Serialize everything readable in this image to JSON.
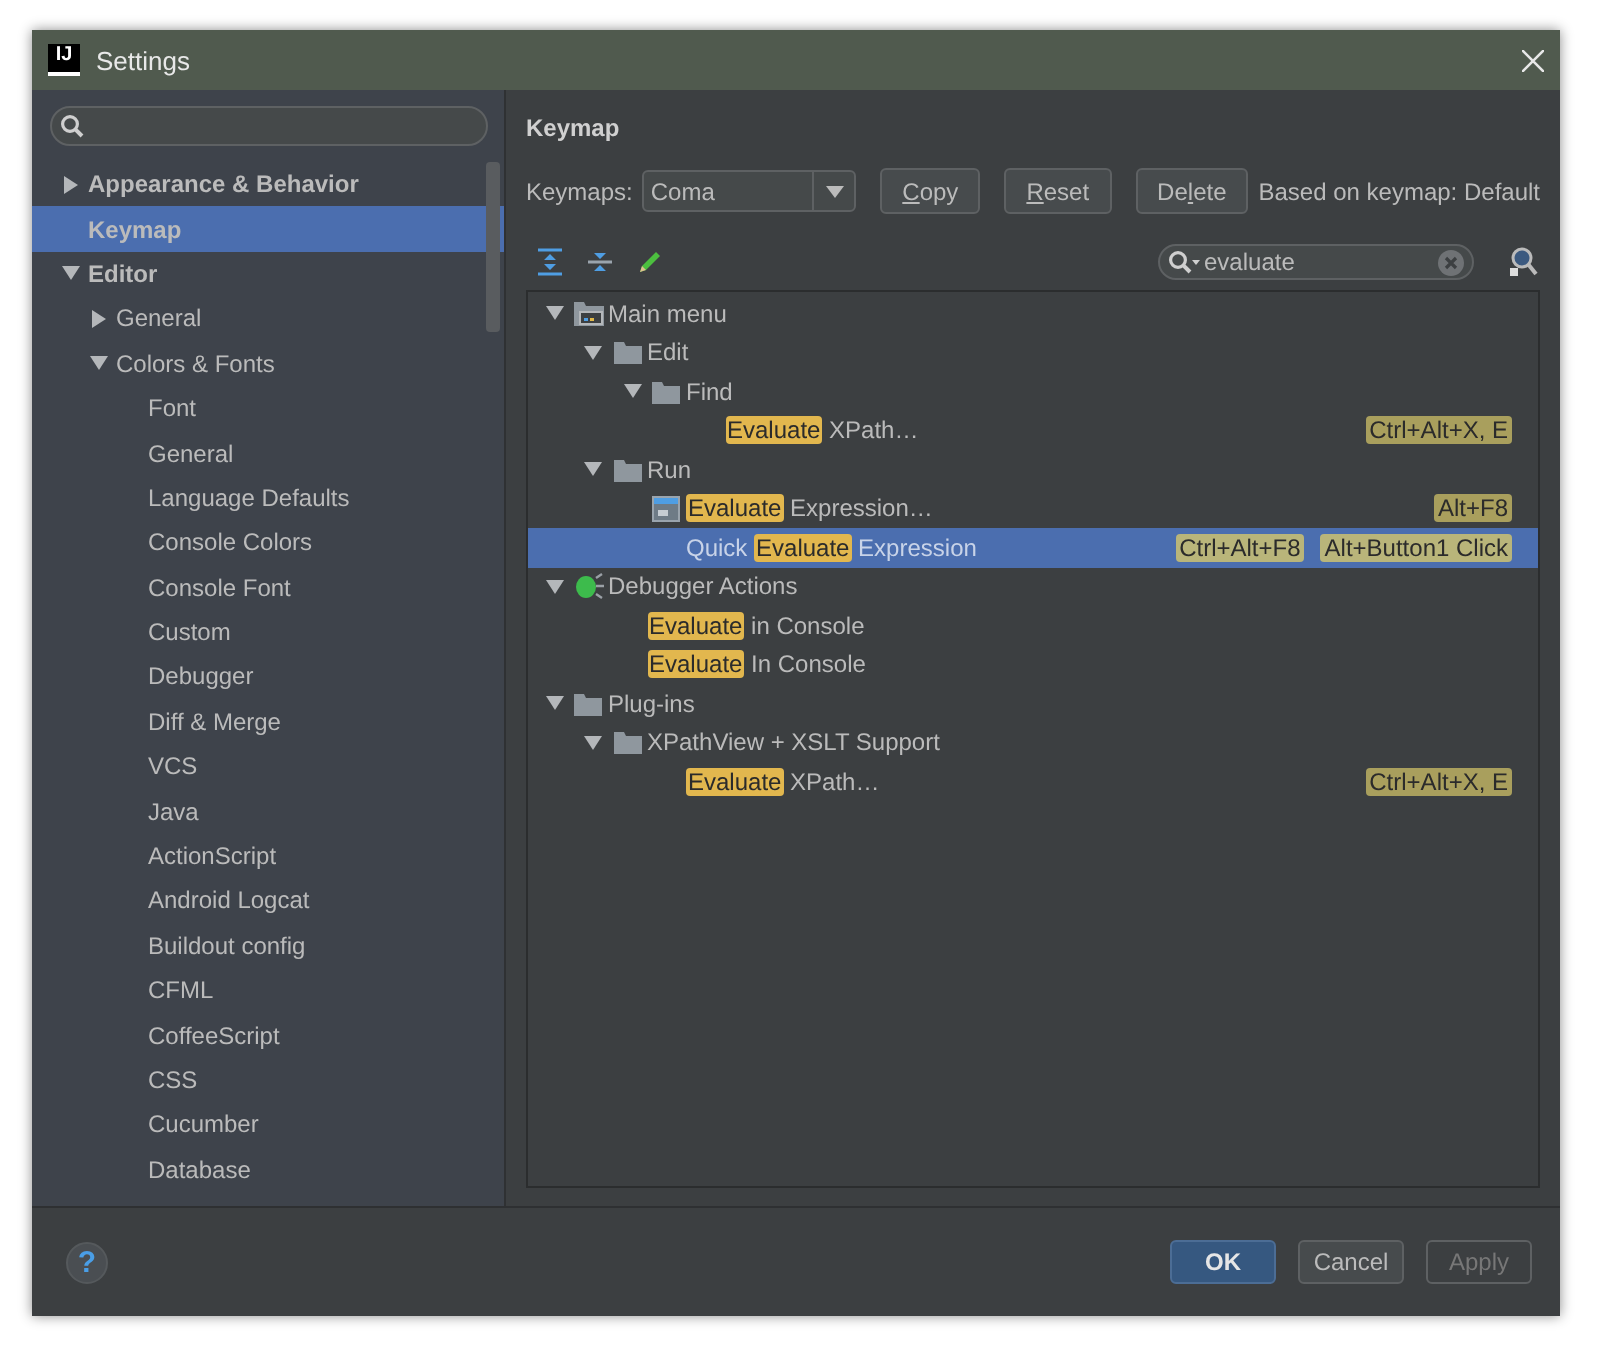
{
  "window": {
    "logo_text": "IJ",
    "title": "Settings"
  },
  "sidebar": {
    "items": [
      {
        "label": "Appearance & Behavior",
        "expanded": false,
        "selected": false
      },
      {
        "label": "Keymap",
        "selected": true
      },
      {
        "label": "Editor",
        "expanded": true,
        "selected": false,
        "children": [
          {
            "label": "General",
            "expanded": false,
            "selected": false
          },
          {
            "label": "Colors & Fonts",
            "expanded": true,
            "selected": false,
            "children": [
              {
                "label": "Font",
                "selected": false
              },
              {
                "label": "General",
                "selected": false
              },
              {
                "label": "Language Defaults",
                "selected": false
              },
              {
                "label": "Console Colors",
                "selected": false
              },
              {
                "label": "Console Font",
                "selected": false
              },
              {
                "label": "Custom",
                "selected": false
              },
              {
                "label": "Debugger",
                "selected": false
              },
              {
                "label": "Diff & Merge",
                "selected": false
              },
              {
                "label": "VCS",
                "selected": false
              },
              {
                "label": "Java",
                "selected": false
              },
              {
                "label": "ActionScript",
                "selected": false
              },
              {
                "label": "Android Logcat",
                "selected": false
              },
              {
                "label": "Buildout config",
                "selected": false
              },
              {
                "label": "CFML",
                "selected": false
              },
              {
                "label": "CoffeeScript",
                "selected": false
              },
              {
                "label": "CSS",
                "selected": false
              },
              {
                "label": "Cucumber",
                "selected": false
              },
              {
                "label": "Database",
                "selected": false
              }
            ]
          }
        ]
      }
    ]
  },
  "keymap": {
    "title": "Keymap",
    "keymaps_label": "Keymaps:",
    "keymap_value": "Coma",
    "buttons": [
      {
        "key": "C",
        "after": "opy"
      },
      {
        "key": "R",
        "after": "eset"
      },
      {
        "before": "De",
        "key": "l",
        "after": "ete"
      }
    ],
    "based_on": "Based on keymap: Default",
    "search": {
      "value": "evaluate"
    },
    "tree": [
      {
        "kind": "main-menu",
        "parts": [
          {
            "text": "Main menu",
            "match": false
          }
        ],
        "expanded": true,
        "selected": false,
        "children": [
          {
            "kind": "folder",
            "parts": [
              {
                "text": "Edit",
                "match": false
              }
            ],
            "expanded": true,
            "selected": false,
            "children": [
              {
                "kind": "folder",
                "parts": [
                  {
                    "text": "Find",
                    "match": false
                  }
                ],
                "expanded": true,
                "selected": false,
                "children": [
                  {
                    "parts": [
                      {
                        "text": "Evaluate",
                        "match": true
                      },
                      {
                        "text": " XPath…",
                        "match": false
                      }
                    ],
                    "selected": false,
                    "shortcuts": [
                      "Ctrl+Alt+X, E"
                    ]
                  }
                ]
              }
            ]
          },
          {
            "kind": "folder",
            "parts": [
              {
                "text": "Run",
                "match": false
              }
            ],
            "expanded": true,
            "selected": false,
            "children": [
              {
                "kind": "expression",
                "parts": [
                  {
                    "text": "Evaluate",
                    "match": true
                  },
                  {
                    "text": " Expression…",
                    "match": false
                  }
                ],
                "selected": false,
                "shortcuts": [
                  "Alt+F8"
                ]
              },
              {
                "parts": [
                  {
                    "text": "Quick ",
                    "match": false
                  },
                  {
                    "text": "Evaluate",
                    "match": true
                  },
                  {
                    "text": " Expression",
                    "match": false
                  }
                ],
                "selected": true,
                "shortcuts": [
                  "Ctrl+Alt+F8",
                  "Alt+Button1 Click"
                ]
              }
            ]
          }
        ]
      },
      {
        "kind": "debugger",
        "parts": [
          {
            "text": "Debugger Actions",
            "match": false
          }
        ],
        "expanded": true,
        "selected": false,
        "children": [
          {
            "parts": [
              {
                "text": "Evaluate",
                "match": true
              },
              {
                "text": " in Console",
                "match": false
              }
            ],
            "selected": false
          },
          {
            "parts": [
              {
                "text": "Evaluate",
                "match": true
              },
              {
                "text": " In Console",
                "match": false
              }
            ],
            "selected": false
          }
        ]
      },
      {
        "kind": "folder",
        "parts": [
          {
            "text": "Plug-ins",
            "match": false
          }
        ],
        "expanded": true,
        "selected": false,
        "children": [
          {
            "kind": "folder",
            "parts": [
              {
                "text": "XPathView + XSLT Support",
                "match": false
              }
            ],
            "expanded": true,
            "selected": false,
            "children": [
              {
                "parts": [
                  {
                    "text": "Evaluate",
                    "match": true
                  },
                  {
                    "text": " XPath…",
                    "match": false
                  }
                ],
                "selected": false,
                "shortcuts": [
                  "Ctrl+Alt+X, E"
                ]
              }
            ]
          }
        ]
      }
    ]
  },
  "footer": {
    "help": "?",
    "buttons": [
      {
        "label": "OK",
        "default": true,
        "disabled": false
      },
      {
        "label": "Cancel",
        "default": false,
        "disabled": false
      },
      {
        "label": "Apply",
        "default": false,
        "disabled": true
      }
    ]
  }
}
